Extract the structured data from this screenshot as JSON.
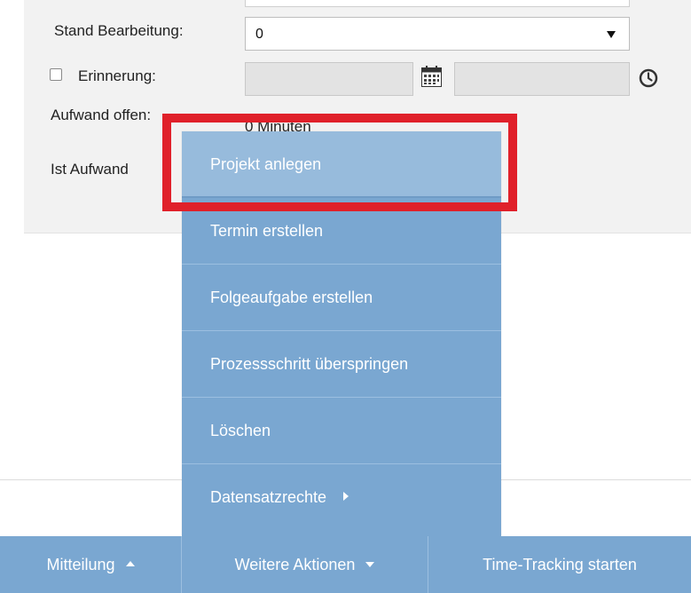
{
  "form": {
    "stand_label": "Stand Bearbeitung:",
    "stand_value": "0",
    "erinnerung_label": "Erinnerung:",
    "erinnerung_checked": false,
    "aufwand_offen_label": "Aufwand offen:",
    "aufwand_offen_value": "0 Minuten",
    "ist_aufwand_label": "Ist Aufwand"
  },
  "menu": {
    "items": [
      {
        "label": "Projekt anlegen"
      },
      {
        "label": "Termin erstellen"
      },
      {
        "label": "Folgeaufgabe erstellen"
      },
      {
        "label": "Prozessschritt überspringen"
      },
      {
        "label": "Löschen"
      },
      {
        "label": "Datensatzrechte"
      }
    ]
  },
  "toolbar": {
    "mitteilung_label": "Mitteilung",
    "weitere_aktionen_label": "Weitere Aktionen",
    "time_tracking_label": "Time-Tracking starten"
  },
  "colors": {
    "menu_bg": "#7aa7d1",
    "menu_hover": "#97bbdc",
    "highlight": "#e0202a",
    "panel_bg": "#f2f2f2"
  },
  "icons": {
    "calendar": "calendar-icon",
    "clock": "clock-icon",
    "select_arrow": "chevron-down-icon",
    "submenu_arrow": "chevron-right-icon"
  }
}
